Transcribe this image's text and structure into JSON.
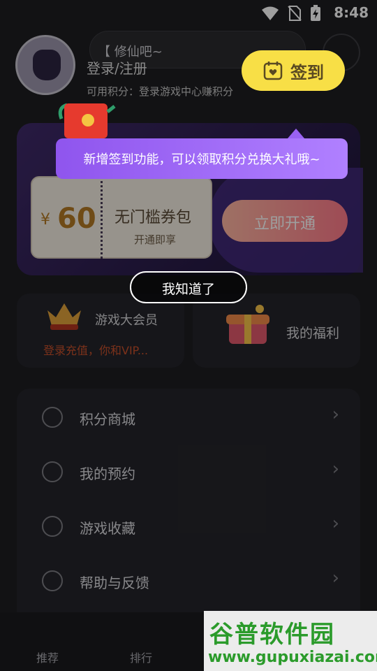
{
  "status_bar": {
    "time": "8:48"
  },
  "header": {
    "search_text": "【 修仙吧~",
    "login_text": "登录/注册",
    "points_text": "可用积分：登录游戏中心赚积分"
  },
  "vip_card": {
    "coupon_yen": "¥",
    "coupon_price": "60",
    "coupon_title": "无门槛券包",
    "coupon_sub": "开通即享",
    "open_button": "立即开通"
  },
  "cards": {
    "vip_title": "游戏大会员",
    "vip_sub": "登录充值，你和VIP...",
    "welfare_title": "我的福利"
  },
  "menu": {
    "items": [
      {
        "label": "积分商城",
        "icon": "star-icon"
      },
      {
        "label": "我的预约",
        "icon": "alarm-clock-icon"
      },
      {
        "label": "游戏收藏",
        "icon": "flower-icon"
      },
      {
        "label": "帮助与反馈",
        "icon": "smile-icon"
      }
    ]
  },
  "tabs": [
    "推荐",
    "排行"
  ],
  "overlay": {
    "signin_label": "签到",
    "tooltip_text": "新增签到功能，可以领取积分兑换大礼哦~",
    "gotit_label": "我知道了"
  },
  "watermark": {
    "title": "谷普软件园",
    "url": "www.gupuxiazai.com"
  },
  "colors": {
    "accent_yellow": "#f8df46",
    "tooltip_purple": "#9a62f2",
    "vip_purple": "#3f2a6a"
  }
}
